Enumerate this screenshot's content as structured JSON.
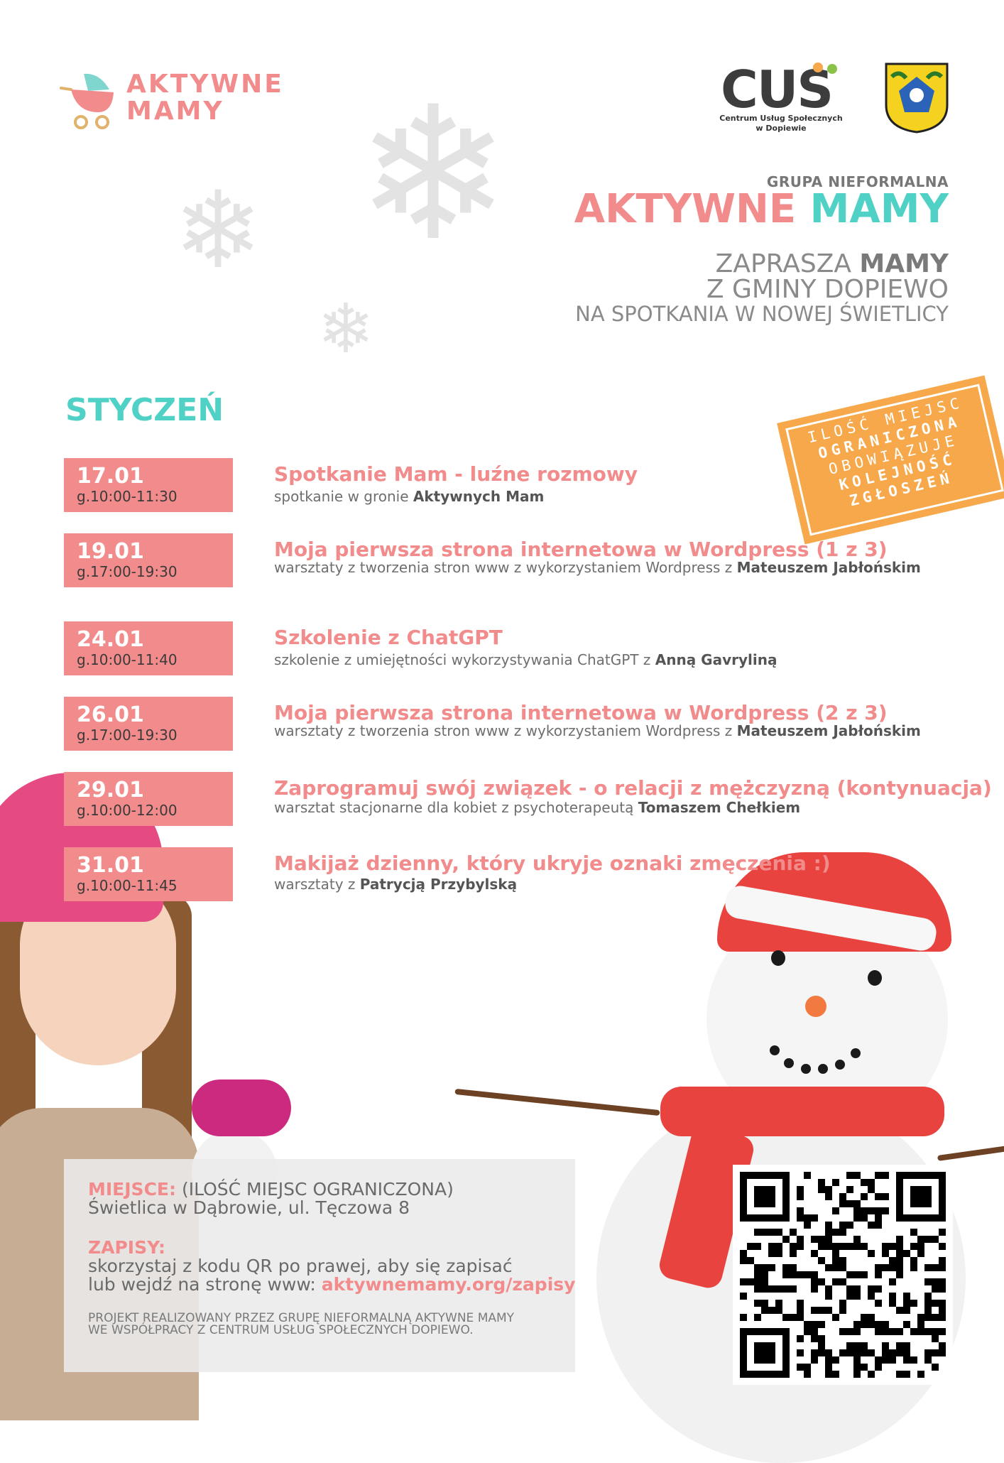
{
  "logo": {
    "line1": "AKTYWNE",
    "line2": "MAMY"
  },
  "partners": {
    "cus_name": "CUS",
    "cus_sub_line1": "Centrum Usług Społecznych",
    "cus_sub_line2": "w Dopiewie"
  },
  "header": {
    "group_label": "GRUPA NIEFORMALNA",
    "title_word1": "AKTYWNE",
    "title_word2": "MAMY",
    "invite_line1_a": "ZAPRASZA ",
    "invite_line1_b": "MAMY",
    "invite_line2": "Z GMINY DOPIEWO",
    "invite_line3": "NA SPOTKANIA W NOWEJ ŚWIETLICY"
  },
  "month": "STYCZEŃ",
  "badge": {
    "line1": "ILOŚĆ MIEJSC",
    "line2": "OGRANICZONA",
    "line3": "OBOWIĄZUJE",
    "line4": "KOLEJNOŚĆ",
    "line5": "ZGŁOSZEŃ"
  },
  "events": [
    {
      "date": "17.01",
      "time": "g.10:00-11:30",
      "title": "Spotkanie Mam - luźne rozmowy",
      "desc": "spotkanie w gronie ",
      "desc_bold": "Aktywnych Mam"
    },
    {
      "date": "19.01",
      "time": "g.17:00-19:30",
      "title": "Moja pierwsza strona internetowa w Wordpress (1 z 3)",
      "desc": "warsztaty z tworzenia stron www z wykorzystaniem Wordpress z ",
      "desc_bold": "Mateuszem Jabłońskim"
    },
    {
      "date": "24.01",
      "time": "g.10:00-11:40",
      "title": "Szkolenie z ChatGPT",
      "desc": "szkolenie z umiejętności wykorzystywania ChatGPT z ",
      "desc_bold": "Anną Gavryliną"
    },
    {
      "date": "26.01",
      "time": "g.17:00-19:30",
      "title": "Moja pierwsza strona internetowa w Wordpress (2 z 3)",
      "desc": "warsztaty z tworzenia stron www z wykorzystaniem Wordpress z ",
      "desc_bold": "Mateuszem Jabłońskim"
    },
    {
      "date": "29.01",
      "time": "g.10:00-12:00",
      "title": "Zaprogramuj swój związek - o relacji z mężczyzną (kontynuacja)",
      "desc": "warsztat stacjonarne dla kobiet z psychoterapeutą  ",
      "desc_bold": "Tomaszem Chełkiem"
    },
    {
      "date": "31.01",
      "time": "g.10:00-11:45",
      "title": "Makijaż dzienny, który ukryje oznaki zmęczenia :)",
      "desc": "warsztaty z ",
      "desc_bold": "Patrycją Przybylską"
    }
  ],
  "info": {
    "place_label": "MIEJSCE:",
    "place_note": " (ILOŚĆ MIEJSC OGRANICZONA)",
    "place_value": "Świetlica w Dąbrowie, ul. Tęczowa 8",
    "signup_label": "ZAPISY:",
    "signup_line1": "skorzystaj z kodu QR po prawej, aby się zapisać",
    "signup_line2": "lub wejdź na stronę www: ",
    "signup_link": "aktywnemamy.org/zapisy",
    "footer_line1": "PROJEKT REALIZOWANY PRZEZ GRUPĘ NIEFORMALNĄ AKTYWNE MAMY",
    "footer_line2": "WE WSPÓŁPRACY Z CENTRUM USŁUG SPOŁECZNYCH DOPIEWO."
  },
  "colors": {
    "pink": "#f28b8b",
    "teal": "#4fd1c5",
    "orange": "#f7a84b",
    "grey": "#8a8a8a"
  }
}
